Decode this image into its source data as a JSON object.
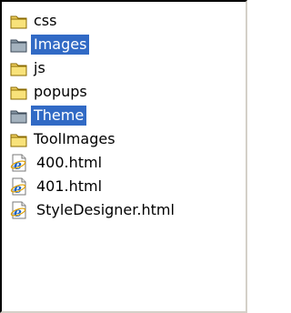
{
  "tree": {
    "items": [
      {
        "label": "css",
        "type": "folder",
        "selected": false,
        "icon": "folder-icon"
      },
      {
        "label": "Images",
        "type": "folder",
        "selected": true,
        "icon": "folder-icon"
      },
      {
        "label": "js",
        "type": "folder",
        "selected": false,
        "icon": "folder-icon"
      },
      {
        "label": "popups",
        "type": "folder",
        "selected": false,
        "icon": "folder-icon"
      },
      {
        "label": "Theme",
        "type": "folder",
        "selected": true,
        "icon": "folder-icon"
      },
      {
        "label": "ToolImages",
        "type": "folder",
        "selected": false,
        "icon": "folder-icon"
      },
      {
        "label": "400.html",
        "type": "file",
        "selected": false,
        "icon": "ie-html-file-icon"
      },
      {
        "label": "401.html",
        "type": "file",
        "selected": false,
        "icon": "ie-html-file-icon"
      },
      {
        "label": "StyleDesigner.html",
        "type": "file",
        "selected": false,
        "icon": "ie-html-file-icon"
      }
    ]
  },
  "colors": {
    "selection": "#316ac5",
    "folder": "#f0d060",
    "folder_selected": "#8a9aa8",
    "ie_blue": "#1a63c8"
  }
}
